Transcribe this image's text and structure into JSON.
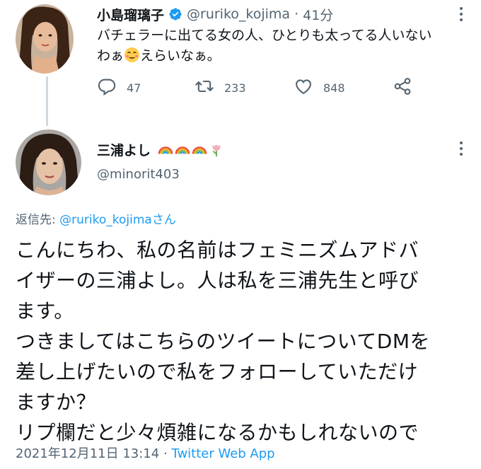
{
  "tweet1": {
    "name": "小島瑠璃子",
    "handle": "@ruriko_kojima",
    "dot": "·",
    "time": "41分",
    "text_line1": "バチェラーに出てる女の人、ひとりも太ってる人いない",
    "text_line2_before": "わぁ",
    "text_line2_after": "えらいなぁ。",
    "emoji": "smiling-face-with-blush-emoji",
    "actions": {
      "reply_count": "47",
      "retweet_count": "233",
      "like_count": "848"
    },
    "verified_color": "#1d9bf0"
  },
  "tweet2": {
    "name": "三浦よし",
    "emojis": [
      "rainbow-emoji",
      "rainbow-emoji",
      "rainbow-emoji",
      "tulip-emoji"
    ],
    "handle": "@minorit403",
    "reply_label": "返信先:",
    "reply_handle": "@ruriko_kojima",
    "reply_suffix": "さん",
    "body_lines": [
      "こんにちわ、私の名前はフェミニズムアドバ",
      "イザーの三浦よし。人は私を三浦先生と呼び",
      "ます。",
      "つきましてはこちらのツイートについてDMを",
      "差し上げたいので私をフォローしていただけ",
      "ますか？",
      "リプ欄だと少々煩雑になるかもしれないので"
    ],
    "timestamp": "2021年12月11日 13:14",
    "dot": "·",
    "source": "Twitter Web App"
  },
  "colors": {
    "text": "#0f1419",
    "secondary": "#536471",
    "link": "#1d9bf0",
    "thread_line": "#cfd9de"
  }
}
